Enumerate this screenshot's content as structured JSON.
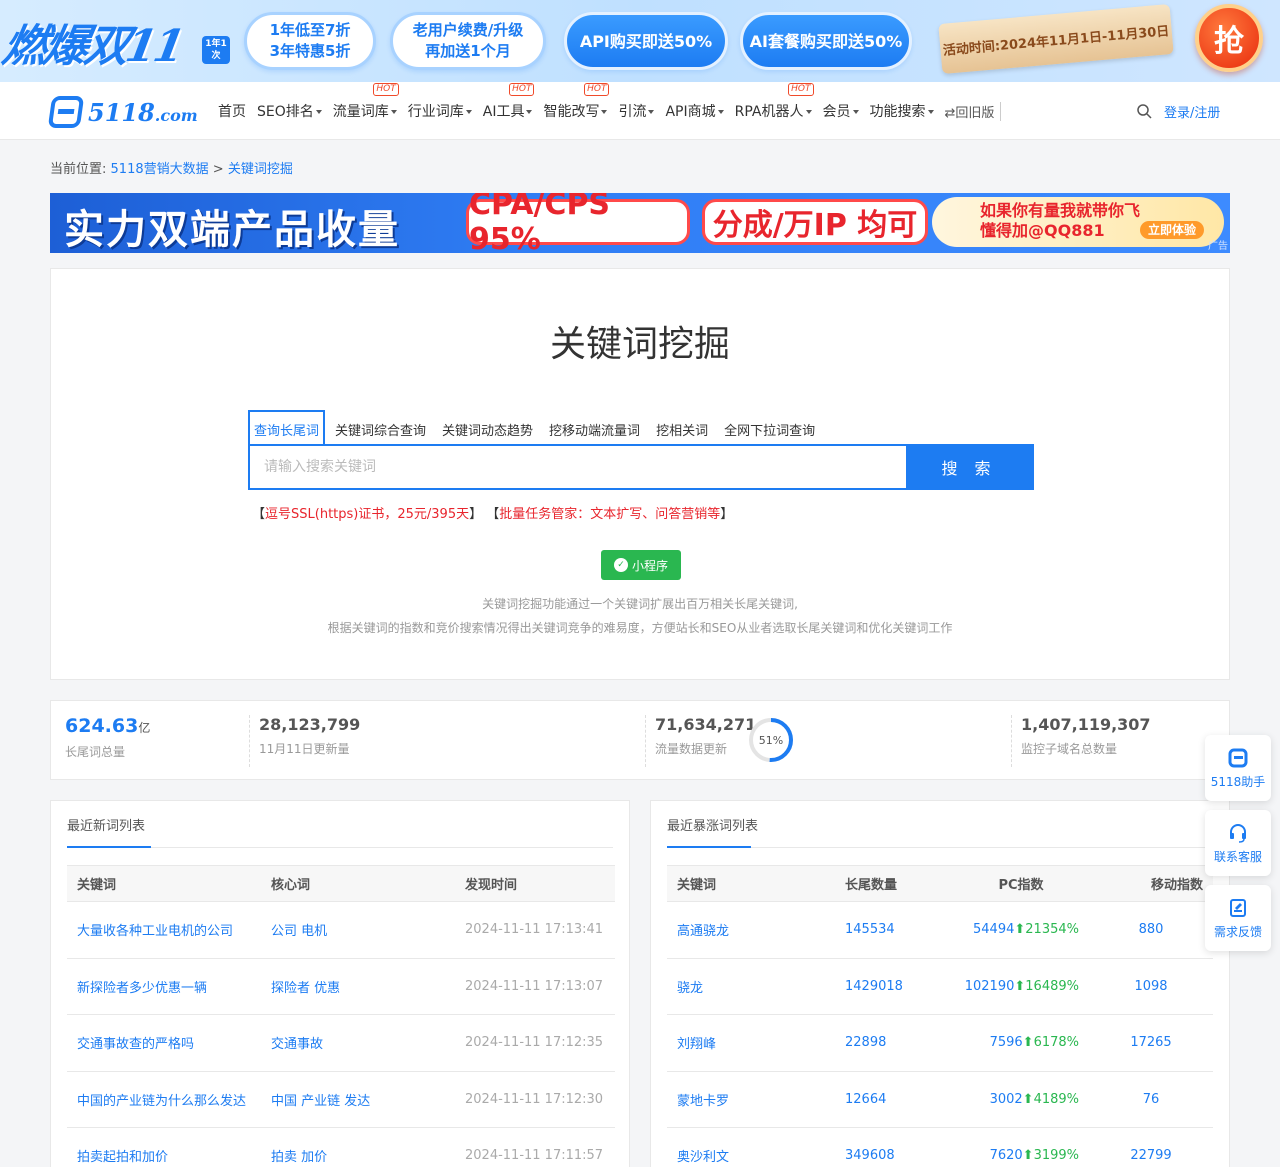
{
  "promo": {
    "logo": "燃爆双11",
    "badge": "1年1次",
    "pills": [
      {
        "line1": "1年低至7折",
        "line2": "3年特惠5折"
      },
      {
        "line1": "老用户续费/升级",
        "line2": "再加送1个月"
      },
      {
        "line1": "API购买即送50%",
        "line2": ""
      },
      {
        "line1": "AI套餐购买即送50%",
        "line2": ""
      }
    ],
    "period": "活动时间:2024年11月1日-11月30日",
    "grab": "抢"
  },
  "nav": {
    "logo_text": "5118",
    "logo_suffix": ".com",
    "items": [
      {
        "label": "首页",
        "caret": false,
        "hot": false
      },
      {
        "label": "SEO排名",
        "caret": true,
        "hot": false
      },
      {
        "label": "流量词库",
        "caret": true,
        "hot": true
      },
      {
        "label": "行业词库",
        "caret": true,
        "hot": false
      },
      {
        "label": "AI工具",
        "caret": true,
        "hot": true
      },
      {
        "label": "智能改写",
        "caret": true,
        "hot": true
      },
      {
        "label": "引流",
        "caret": true,
        "hot": false
      },
      {
        "label": "API商城",
        "caret": true,
        "hot": false
      },
      {
        "label": "RPA机器人",
        "caret": true,
        "hot": true
      },
      {
        "label": "会员",
        "caret": true,
        "hot": false
      },
      {
        "label": "功能搜索",
        "caret": true,
        "hot": false
      }
    ],
    "hot_label": "HOT",
    "old_version": "⇄回旧版",
    "login": "登录/注册"
  },
  "breadcrumb": {
    "prefix": "当前位置:",
    "home": "5118营销大数据",
    "sep": ">",
    "current": "关键词挖掘"
  },
  "ad": {
    "headline": "实力双端产品收量",
    "box1": "CPA/CPS 95%",
    "box2": "分成/万IP 均可",
    "right_line1": "如果你有量我就带你飞",
    "right_line2": "懂得加@QQ881",
    "try": "立即体验",
    "tag": "广告"
  },
  "search": {
    "title": "关键词挖掘",
    "tabs": [
      "查询长尾词",
      "关键词综合查询",
      "关键词动态趋势",
      "挖移动端流量词",
      "挖相关词",
      "全网下拉词查询"
    ],
    "active_tab": 0,
    "placeholder": "请输入搜索关键词",
    "value": "",
    "button": "搜 索",
    "links": [
      {
        "open": "【",
        "text": "逗号SSL(https)证书，25元/395天",
        "close": "】"
      },
      {
        "open": "【",
        "text": "批量任务管家：文本扩写、问答营销等",
        "close": "】"
      }
    ],
    "mini_program": "小程序",
    "desc1": "关键词挖掘功能通过一个关键词扩展出百万相关长尾关键词,",
    "desc2": "根据关键词的指数和竞价搜索情况得出关键词竞争的难易度，方便站长和SEO从业者选取长尾关键词和优化关键词工作"
  },
  "stats": {
    "total": {
      "value": "624.63",
      "unit": "亿",
      "label": "长尾词总量"
    },
    "updated": {
      "value": "28,123,799",
      "label": "11月11日更新量"
    },
    "traffic": {
      "value": "71,634,271",
      "label": "流量数据更新",
      "percent": 51,
      "percent_label": "51%"
    },
    "domains": {
      "value": "1,407,119,307",
      "label": "监控子域名总数量"
    }
  },
  "new_words": {
    "title": "最近新词列表",
    "headers": [
      "关键词",
      "核心词",
      "发现时间"
    ],
    "rows": [
      [
        "大量收各种工业电机的公司",
        "公司 电机",
        "2024-11-11 17:13:41"
      ],
      [
        "新探险者多少优惠一辆",
        "探险者 优惠",
        "2024-11-11 17:13:07"
      ],
      [
        "交通事故查的严格吗",
        "交通事故",
        "2024-11-11 17:12:35"
      ],
      [
        "中国的产业链为什么那么发达",
        "中国 产业链 发达",
        "2024-11-11 17:12:30"
      ],
      [
        "拍卖起拍和加价",
        "拍卖 加价",
        "2024-11-11 17:11:57"
      ]
    ]
  },
  "surge_words": {
    "title": "最近暴涨词列表",
    "headers": [
      "关键词",
      "长尾数量",
      "PC指数",
      "移动指数"
    ],
    "rows": [
      [
        "高通骁龙",
        "145534",
        "54494",
        "21354%",
        "880"
      ],
      [
        "骁龙",
        "1429018",
        "102190",
        "16489%",
        "1098"
      ],
      [
        "刘翔峰",
        "22898",
        "7596",
        "6178%",
        "17265"
      ],
      [
        "蒙地卡罗",
        "12664",
        "3002",
        "4189%",
        "76"
      ],
      [
        "奥沙利文",
        "349608",
        "7620",
        "3199%",
        "22799"
      ]
    ],
    "up_arrow": "⬆"
  },
  "float_tools": [
    {
      "label": "5118助手",
      "icon": "logo-icon"
    },
    {
      "label": "联系客服",
      "icon": "headset-icon"
    },
    {
      "label": "需求反馈",
      "icon": "feedback-icon"
    }
  ],
  "colors": {
    "brand": "#1d7cf2",
    "hot": "#f04a2a",
    "up": "#2ab750",
    "link_red": "#e8252d"
  }
}
